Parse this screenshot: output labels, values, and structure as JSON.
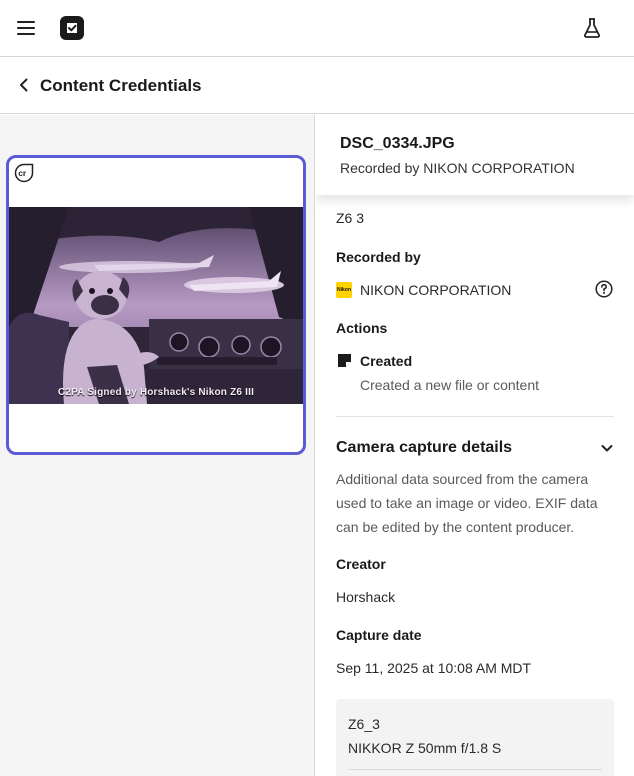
{
  "header": {
    "menu_icon": "hamburger-menu-icon",
    "logo_icon": "content-credentials-logo-icon",
    "labs_icon": "flask-icon"
  },
  "breadcrumb": {
    "back_icon": "chevron-left-icon",
    "title": "Content Credentials"
  },
  "preview": {
    "badge_icon": "cr-badge-icon",
    "caption": "C2PA Signed by Horshack's Nikon Z6 III",
    "accent_color": "#5b5bd6"
  },
  "details": {
    "file_name": "DSC_0334.JPG",
    "recorded_by_line": "Recorded by NIKON CORPORATION",
    "device": "Z6 3",
    "recorded_by_label": "Recorded by",
    "recorded_by_value": "NIKON CORPORATION",
    "actions_label": "Actions",
    "action_name": "Created",
    "action_desc": "Created a new file or content",
    "camera_section_title": "Camera capture details",
    "camera_desc": "Additional data sourced from the camera used to take an image or video. EXIF data can be edited by the content producer.",
    "creator_label": "Creator",
    "creator_value": "Horshack",
    "capture_date_label": "Capture date",
    "capture_date_value": "Sep 11, 2025 at 10:08 AM MDT",
    "camera_model": "Z6_3",
    "lens": "NIKKOR Z 50mm f/1.8 S"
  }
}
